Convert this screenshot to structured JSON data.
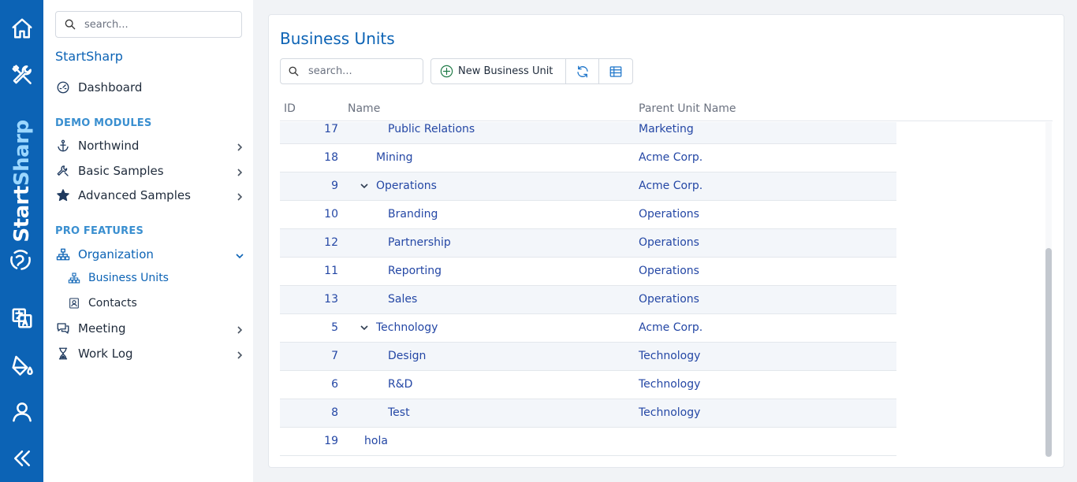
{
  "brand": {
    "part1": "Start",
    "part2": "Sharp"
  },
  "rail": {
    "items": [
      "home-icon",
      "tools-icon",
      "translate-icon",
      "theme-paint-icon",
      "user-icon",
      "collapse-icon"
    ]
  },
  "sidebar": {
    "search_placeholder": "search...",
    "app_title": "StartSharp",
    "dashboard_label": "Dashboard",
    "demo_modules_label": "DEMO MODULES",
    "northwind_label": "Northwind",
    "basic_samples_label": "Basic Samples",
    "advanced_samples_label": "Advanced Samples",
    "pro_features_label": "PRO FEATURES",
    "organization_label": "Organization",
    "business_units_label": "Business Units",
    "contacts_label": "Contacts",
    "meeting_label": "Meeting",
    "work_log_label": "Work Log"
  },
  "main": {
    "title": "Business Units",
    "search_placeholder": "search...",
    "new_button_label": "New Business Unit",
    "columns": {
      "id": "ID",
      "name": "Name",
      "parent": "Parent Unit Name"
    },
    "rows": [
      {
        "id": "17",
        "name": "Public Relations",
        "parent": "Marketing",
        "level": 2,
        "toggle": false
      },
      {
        "id": "18",
        "name": "Mining",
        "parent": "Acme Corp.",
        "level": 1,
        "toggle": false
      },
      {
        "id": "9",
        "name": "Operations",
        "parent": "Acme Corp.",
        "level": 1,
        "toggle": true
      },
      {
        "id": "10",
        "name": "Branding",
        "parent": "Operations",
        "level": 2,
        "toggle": false
      },
      {
        "id": "12",
        "name": "Partnership",
        "parent": "Operations",
        "level": 2,
        "toggle": false
      },
      {
        "id": "11",
        "name": "Reporting",
        "parent": "Operations",
        "level": 2,
        "toggle": false
      },
      {
        "id": "13",
        "name": "Sales",
        "parent": "Operations",
        "level": 2,
        "toggle": false
      },
      {
        "id": "5",
        "name": "Technology",
        "parent": "Acme Corp.",
        "level": 1,
        "toggle": true
      },
      {
        "id": "7",
        "name": "Design",
        "parent": "Technology",
        "level": 2,
        "toggle": false
      },
      {
        "id": "6",
        "name": "R&D",
        "parent": "Technology",
        "level": 2,
        "toggle": false
      },
      {
        "id": "8",
        "name": "Test",
        "parent": "Technology",
        "level": 2,
        "toggle": false
      },
      {
        "id": "19",
        "name": "hola",
        "parent": "",
        "level": 0,
        "toggle": false
      }
    ]
  }
}
